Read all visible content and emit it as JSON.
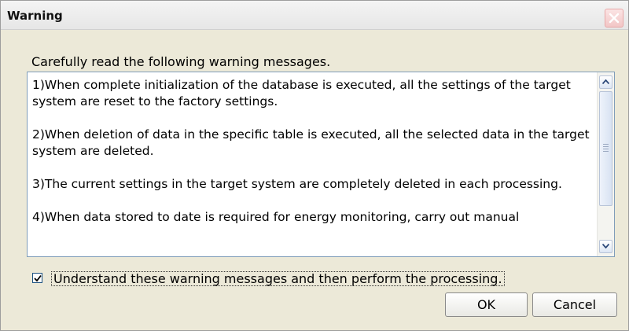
{
  "window": {
    "title": "Warning",
    "close_icon": "close-icon"
  },
  "dialog": {
    "instruction": "Carefully read the following warning messages.",
    "messages": [
      "1)When complete initialization of the database is executed, all the settings of the target system are reset to the factory settings.",
      "2)When deletion of data in the specific table is executed, all the selected data in the target system are deleted.",
      "3)The current settings in the target system are completely deleted in each processing.",
      "4)When data stored to date is required for energy monitoring, carry out manual"
    ],
    "checkbox": {
      "label": "Understand these warning messages and then perform the processing.",
      "checked": true
    },
    "buttons": {
      "ok": "OK",
      "cancel": "Cancel"
    }
  },
  "colors": {
    "dialog_bg": "#ece9d8",
    "close_button": "#f2c6c6",
    "border": "#7f9db9"
  }
}
